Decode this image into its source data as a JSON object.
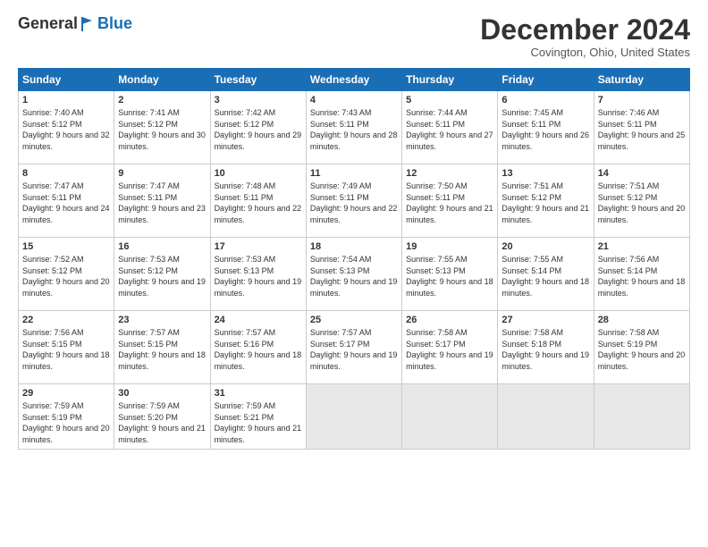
{
  "header": {
    "logo_general": "General",
    "logo_blue": "Blue",
    "month_title": "December 2024",
    "location": "Covington, Ohio, United States"
  },
  "days_of_week": [
    "Sunday",
    "Monday",
    "Tuesday",
    "Wednesday",
    "Thursday",
    "Friday",
    "Saturday"
  ],
  "weeks": [
    [
      {
        "day": "1",
        "sunrise": "7:40 AM",
        "sunset": "5:12 PM",
        "daylight": "9 hours and 32 minutes."
      },
      {
        "day": "2",
        "sunrise": "7:41 AM",
        "sunset": "5:12 PM",
        "daylight": "9 hours and 30 minutes."
      },
      {
        "day": "3",
        "sunrise": "7:42 AM",
        "sunset": "5:12 PM",
        "daylight": "9 hours and 29 minutes."
      },
      {
        "day": "4",
        "sunrise": "7:43 AM",
        "sunset": "5:11 PM",
        "daylight": "9 hours and 28 minutes."
      },
      {
        "day": "5",
        "sunrise": "7:44 AM",
        "sunset": "5:11 PM",
        "daylight": "9 hours and 27 minutes."
      },
      {
        "day": "6",
        "sunrise": "7:45 AM",
        "sunset": "5:11 PM",
        "daylight": "9 hours and 26 minutes."
      },
      {
        "day": "7",
        "sunrise": "7:46 AM",
        "sunset": "5:11 PM",
        "daylight": "9 hours and 25 minutes."
      }
    ],
    [
      {
        "day": "8",
        "sunrise": "7:47 AM",
        "sunset": "5:11 PM",
        "daylight": "9 hours and 24 minutes."
      },
      {
        "day": "9",
        "sunrise": "7:47 AM",
        "sunset": "5:11 PM",
        "daylight": "9 hours and 23 minutes."
      },
      {
        "day": "10",
        "sunrise": "7:48 AM",
        "sunset": "5:11 PM",
        "daylight": "9 hours and 22 minutes."
      },
      {
        "day": "11",
        "sunrise": "7:49 AM",
        "sunset": "5:11 PM",
        "daylight": "9 hours and 22 minutes."
      },
      {
        "day": "12",
        "sunrise": "7:50 AM",
        "sunset": "5:11 PM",
        "daylight": "9 hours and 21 minutes."
      },
      {
        "day": "13",
        "sunrise": "7:51 AM",
        "sunset": "5:12 PM",
        "daylight": "9 hours and 21 minutes."
      },
      {
        "day": "14",
        "sunrise": "7:51 AM",
        "sunset": "5:12 PM",
        "daylight": "9 hours and 20 minutes."
      }
    ],
    [
      {
        "day": "15",
        "sunrise": "7:52 AM",
        "sunset": "5:12 PM",
        "daylight": "9 hours and 20 minutes."
      },
      {
        "day": "16",
        "sunrise": "7:53 AM",
        "sunset": "5:12 PM",
        "daylight": "9 hours and 19 minutes."
      },
      {
        "day": "17",
        "sunrise": "7:53 AM",
        "sunset": "5:13 PM",
        "daylight": "9 hours and 19 minutes."
      },
      {
        "day": "18",
        "sunrise": "7:54 AM",
        "sunset": "5:13 PM",
        "daylight": "9 hours and 19 minutes."
      },
      {
        "day": "19",
        "sunrise": "7:55 AM",
        "sunset": "5:13 PM",
        "daylight": "9 hours and 18 minutes."
      },
      {
        "day": "20",
        "sunrise": "7:55 AM",
        "sunset": "5:14 PM",
        "daylight": "9 hours and 18 minutes."
      },
      {
        "day": "21",
        "sunrise": "7:56 AM",
        "sunset": "5:14 PM",
        "daylight": "9 hours and 18 minutes."
      }
    ],
    [
      {
        "day": "22",
        "sunrise": "7:56 AM",
        "sunset": "5:15 PM",
        "daylight": "9 hours and 18 minutes."
      },
      {
        "day": "23",
        "sunrise": "7:57 AM",
        "sunset": "5:15 PM",
        "daylight": "9 hours and 18 minutes."
      },
      {
        "day": "24",
        "sunrise": "7:57 AM",
        "sunset": "5:16 PM",
        "daylight": "9 hours and 18 minutes."
      },
      {
        "day": "25",
        "sunrise": "7:57 AM",
        "sunset": "5:17 PM",
        "daylight": "9 hours and 19 minutes."
      },
      {
        "day": "26",
        "sunrise": "7:58 AM",
        "sunset": "5:17 PM",
        "daylight": "9 hours and 19 minutes."
      },
      {
        "day": "27",
        "sunrise": "7:58 AM",
        "sunset": "5:18 PM",
        "daylight": "9 hours and 19 minutes."
      },
      {
        "day": "28",
        "sunrise": "7:58 AM",
        "sunset": "5:19 PM",
        "daylight": "9 hours and 20 minutes."
      }
    ],
    [
      {
        "day": "29",
        "sunrise": "7:59 AM",
        "sunset": "5:19 PM",
        "daylight": "9 hours and 20 minutes."
      },
      {
        "day": "30",
        "sunrise": "7:59 AM",
        "sunset": "5:20 PM",
        "daylight": "9 hours and 21 minutes."
      },
      {
        "day": "31",
        "sunrise": "7:59 AM",
        "sunset": "5:21 PM",
        "daylight": "9 hours and 21 minutes."
      },
      null,
      null,
      null,
      null
    ]
  ]
}
